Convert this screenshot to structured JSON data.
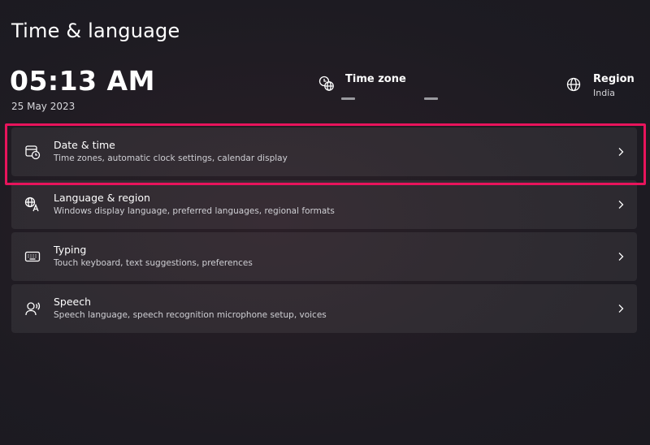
{
  "page": {
    "title": "Time & language"
  },
  "clock": {
    "time": "05:13 AM",
    "date": "25 May 2023"
  },
  "time_zone": {
    "label": "Time zone",
    "icon": "globe-clock-icon"
  },
  "region": {
    "label": "Region",
    "value": "India",
    "icon": "globe-icon"
  },
  "settings": [
    {
      "title": "Date & time",
      "subtitle": "Time zones, automatic clock settings, calendar display",
      "icon": "calendar-clock-icon"
    },
    {
      "title": "Language & region",
      "subtitle": "Windows display language, preferred languages, regional formats",
      "icon": "language-icon"
    },
    {
      "title": "Typing",
      "subtitle": "Touch keyboard, text suggestions, preferences",
      "icon": "keyboard-icon"
    },
    {
      "title": "Speech",
      "subtitle": "Speech language, speech recognition microphone setup, voices",
      "icon": "speech-icon"
    }
  ],
  "colors": {
    "highlight": "#e8145c",
    "card_bg": "#2a2630",
    "background": "#1e1b22"
  }
}
